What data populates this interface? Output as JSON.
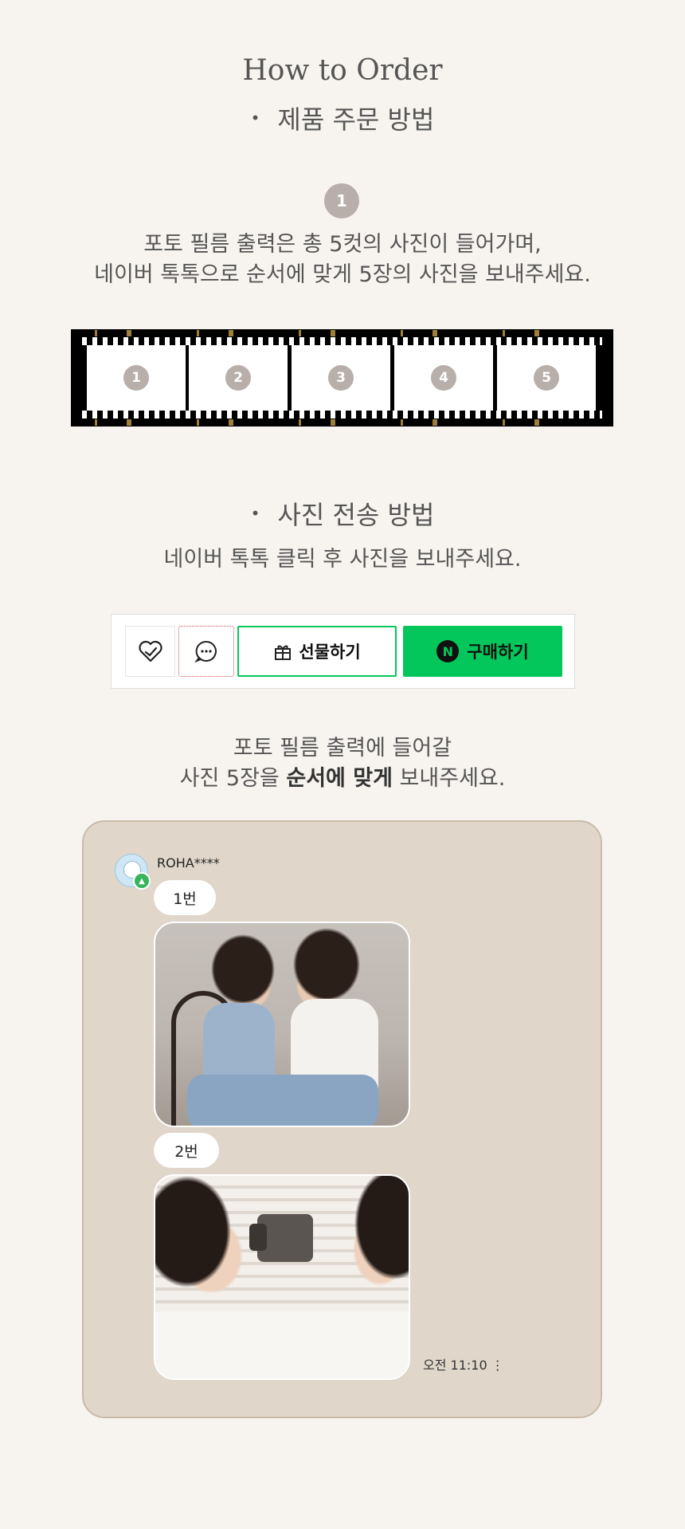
{
  "header": {
    "title": "How to Order",
    "subtitle": "제품 주문 방법"
  },
  "steps": {
    "step_number": "1",
    "intro_line1": "포토 필름 출력은 총 5컷의 사진이 들어가며,",
    "intro_line2": "네이버 톡톡으로 순서에 맞게 5장의 사진을 보내주세요."
  },
  "film_strip": {
    "frames": [
      "1",
      "2",
      "3",
      "4",
      "5"
    ]
  },
  "send_method": {
    "heading": "사진 전송 방법",
    "description": "네이버 톡톡 클릭 후 사진을 보내주세요."
  },
  "purchase_bar": {
    "gift_label": "선물하기",
    "buy_label": "구매하기",
    "buy_logo": "N",
    "icons": [
      "heart-check-icon",
      "chat-icon",
      "gift-icon",
      "naver-pay-icon"
    ],
    "accent_color": "#03c75a"
  },
  "instruction": {
    "line1": "포토 필름 출력에 들어갈",
    "line2_prefix": "사진 5장을 ",
    "line2_bold": "순서에 맞게",
    "line2_suffix": " 보내주세요."
  },
  "chat_example": {
    "username": "ROHA****",
    "messages": [
      {
        "label": "1번"
      },
      {
        "label": "2번"
      }
    ],
    "timestamp": "오전 11:10",
    "colors": {
      "background": "#e0d6ca",
      "border": "#c9bba8"
    }
  }
}
